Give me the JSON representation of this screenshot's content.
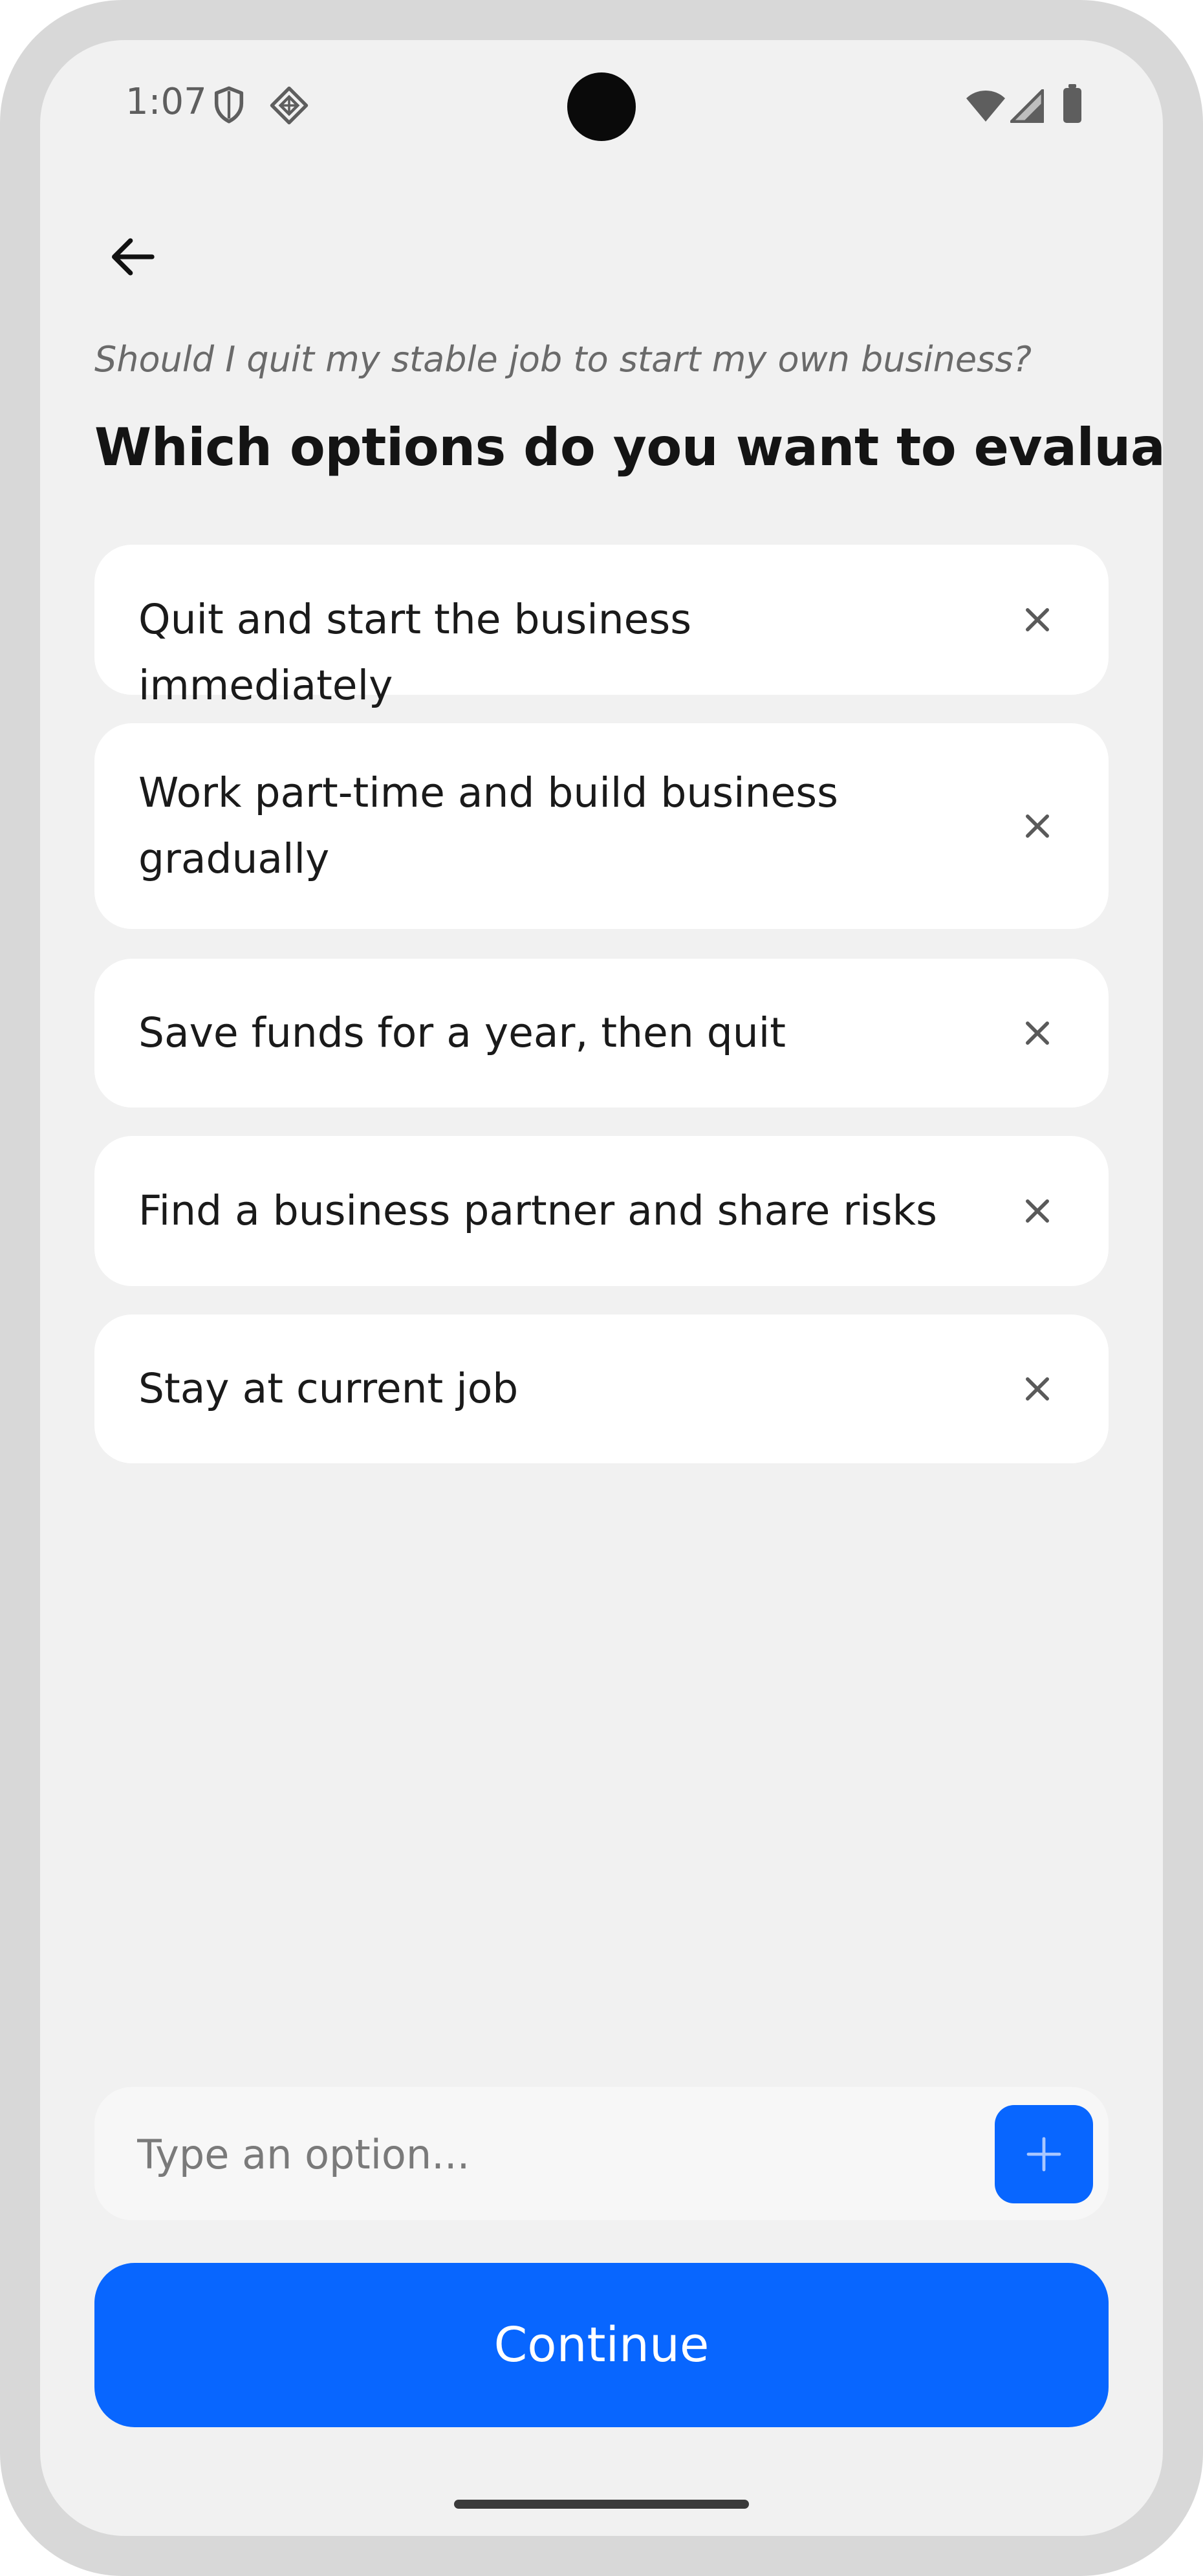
{
  "status_bar": {
    "time": "1:07",
    "icons": [
      "shield-icon",
      "diamond-icon",
      "wifi-icon",
      "signal-icon",
      "battery-icon"
    ]
  },
  "header": {
    "back_icon": "arrow-left-icon",
    "question": "Should I quit my stable job to start my own business?",
    "title": "Which options do you want to evaluate?"
  },
  "options": [
    {
      "label": "Quit and start the business immediately"
    },
    {
      "label": "Work part-time and build business gradually"
    },
    {
      "label": "Save funds for a year, then quit"
    },
    {
      "label": "Find a business partner and share risks"
    },
    {
      "label": "Stay at current job"
    }
  ],
  "input": {
    "placeholder": "Type an option...",
    "value": "",
    "add_icon": "plus-icon"
  },
  "footer": {
    "continue_label": "Continue"
  },
  "colors": {
    "accent": "#0866ff",
    "background": "#f1f1f1",
    "card": "#ffffff",
    "frame": "#d8d8d8"
  }
}
